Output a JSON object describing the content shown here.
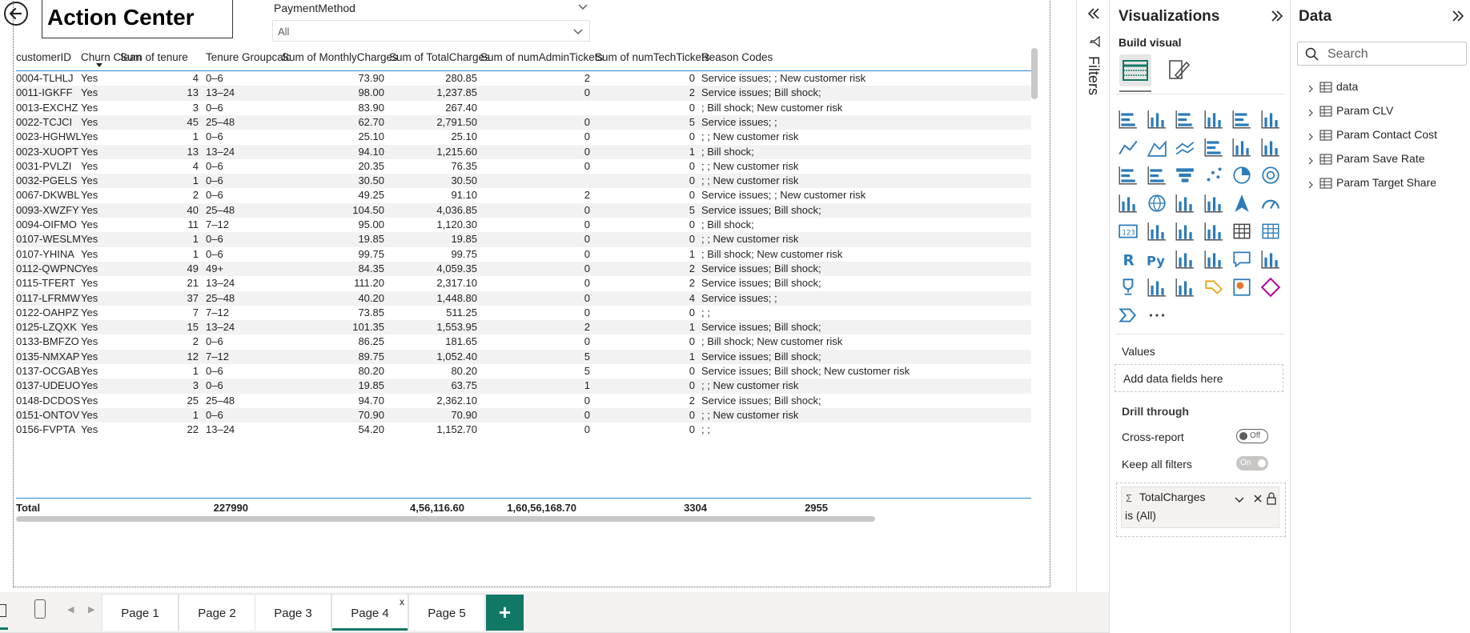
{
  "report": {
    "title": "Action Center",
    "slicer": {
      "title": "PaymentMethod",
      "value": "All"
    }
  },
  "table": {
    "columns": [
      "customerID",
      "Churn Clean",
      "Sum of tenure",
      "Tenure Groupcalc",
      "Sum of MonthlyCharges",
      "Sum of TotalCharges",
      "Sum of numAdminTickets",
      "Sum of numTechTickets",
      "Reason Codes"
    ],
    "rows": [
      [
        "0004-TLHLJ",
        "Yes",
        "4",
        "0–6",
        "73.90",
        "280.85",
        "2",
        "0",
        "Service issues; ; New customer risk"
      ],
      [
        "0011-IGKFF",
        "Yes",
        "13",
        "13–24",
        "98.00",
        "1,237.85",
        "0",
        "2",
        "Service issues; Bill shock;"
      ],
      [
        "0013-EXCHZ",
        "Yes",
        "3",
        "0–6",
        "83.90",
        "267.40",
        "",
        "0",
        "; Bill shock; New customer risk"
      ],
      [
        "0022-TCJCI",
        "Yes",
        "45",
        "25–48",
        "62.70",
        "2,791.50",
        "0",
        "5",
        "Service issues; ;"
      ],
      [
        "0023-HGHWL",
        "Yes",
        "1",
        "0–6",
        "25.10",
        "25.10",
        "0",
        "0",
        "; ; New customer risk"
      ],
      [
        "0023-XUOPT",
        "Yes",
        "13",
        "13–24",
        "94.10",
        "1,215.60",
        "0",
        "1",
        "; Bill shock;"
      ],
      [
        "0031-PVLZI",
        "Yes",
        "4",
        "0–6",
        "20.35",
        "76.35",
        "0",
        "0",
        "; ; New customer risk"
      ],
      [
        "0032-PGELS",
        "Yes",
        "1",
        "0–6",
        "30.50",
        "30.50",
        "",
        "0",
        "; ; New customer risk"
      ],
      [
        "0067-DKWBL",
        "Yes",
        "2",
        "0–6",
        "49.25",
        "91.10",
        "2",
        "0",
        "Service issues; ; New customer risk"
      ],
      [
        "0093-XWZFY",
        "Yes",
        "40",
        "25–48",
        "104.50",
        "4,036.85",
        "0",
        "5",
        "Service issues; Bill shock;"
      ],
      [
        "0094-OIFMO",
        "Yes",
        "11",
        "7–12",
        "95.00",
        "1,120.30",
        "0",
        "0",
        "; Bill shock;"
      ],
      [
        "0107-WESLM",
        "Yes",
        "1",
        "0–6",
        "19.85",
        "19.85",
        "0",
        "0",
        "; ; New customer risk"
      ],
      [
        "0107-YHINA",
        "Yes",
        "1",
        "0–6",
        "99.75",
        "99.75",
        "0",
        "1",
        "; Bill shock; New customer risk"
      ],
      [
        "0112-QWPNC",
        "Yes",
        "49",
        "49+",
        "84.35",
        "4,059.35",
        "0",
        "2",
        "Service issues; Bill shock;"
      ],
      [
        "0115-TFERT",
        "Yes",
        "21",
        "13–24",
        "111.20",
        "2,317.10",
        "0",
        "2",
        "Service issues; Bill shock;"
      ],
      [
        "0117-LFRMW",
        "Yes",
        "37",
        "25–48",
        "40.20",
        "1,448.80",
        "0",
        "4",
        "Service issues; ;"
      ],
      [
        "0122-OAHPZ",
        "Yes",
        "7",
        "7–12",
        "73.85",
        "511.25",
        "0",
        "0",
        "; ;"
      ],
      [
        "0125-LZQXK",
        "Yes",
        "15",
        "13–24",
        "101.35",
        "1,553.95",
        "2",
        "1",
        "Service issues; Bill shock;"
      ],
      [
        "0133-BMFZO",
        "Yes",
        "2",
        "0–6",
        "86.25",
        "181.65",
        "0",
        "0",
        "; Bill shock; New customer risk"
      ],
      [
        "0135-NMXAP",
        "Yes",
        "12",
        "7–12",
        "89.75",
        "1,052.40",
        "5",
        "1",
        "Service issues; Bill shock;"
      ],
      [
        "0137-OCGAB",
        "Yes",
        "1",
        "0–6",
        "80.20",
        "80.20",
        "5",
        "0",
        "Service issues; Bill shock; New customer risk"
      ],
      [
        "0137-UDEUO",
        "Yes",
        "3",
        "0–6",
        "19.85",
        "63.75",
        "1",
        "0",
        "; ; New customer risk"
      ],
      [
        "0148-DCDOS",
        "Yes",
        "25",
        "25–48",
        "94.70",
        "2,362.10",
        "0",
        "2",
        "Service issues; Bill shock;"
      ],
      [
        "0151-ONTOV",
        "Yes",
        "1",
        "0–6",
        "70.90",
        "70.90",
        "0",
        "0",
        "; ; New customer risk"
      ],
      [
        "0156-FVPTA",
        "Yes",
        "22",
        "13–24",
        "54.20",
        "1,152.70",
        "0",
        "0",
        "; ;"
      ]
    ],
    "total": {
      "label": "Total",
      "tenure": "227990",
      "monthly": "4,56,116.60",
      "totalcharges": "1,60,56,168.70",
      "admin": "3304",
      "tech": "2955"
    }
  },
  "filters_pane": {
    "label": "Filters"
  },
  "visualizations": {
    "title": "Visualizations",
    "build_label": "Build visual",
    "values_label": "Values",
    "values_placeholder": "Add data fields here",
    "drill_label": "Drill through",
    "cross_report_label": "Cross-report",
    "cross_report_state": "Off",
    "keep_filters_label": "Keep all filters",
    "keep_filters_state": "On",
    "filter_card": {
      "field": "TotalCharges",
      "condition": "is (All)"
    },
    "icons": [
      "stacked-bar-icon",
      "stacked-column-icon",
      "clustered-bar-icon",
      "clustered-column-icon",
      "100-stacked-bar-icon",
      "100-stacked-column-icon",
      "line-chart-icon",
      "area-chart-icon",
      "stacked-area-icon",
      "ribbon-chart-icon",
      "line-clustered-column-icon",
      "line-stacked-column-icon",
      "ribbon-combo-icon",
      "waterfall-icon",
      "funnel-icon",
      "scatter-icon",
      "pie-icon",
      "donut-icon",
      "treemap-icon",
      "map-icon",
      "filled-map-icon",
      "shape-map-icon",
      "azure-map-icon",
      "gauge-icon",
      "card-icon",
      "multi-row-card-icon",
      "kpi-icon",
      "slicer-icon",
      "table-icon",
      "matrix-icon",
      "r-visual-icon",
      "python-visual-icon",
      "key-influencers-icon",
      "decomposition-tree-icon",
      "qa-icon",
      "paginated-report-icon",
      "trophy-icon",
      "report-icon",
      "smart-narrative-icon",
      "power-automate-icon",
      "power-apps-icon",
      "diamond-icon",
      "chevron-visual-icon",
      "more-visuals-icon"
    ]
  },
  "data_pane": {
    "title": "Data",
    "search_placeholder": "Search",
    "items": [
      "data",
      "Param CLV",
      "Param Contact Cost",
      "Param Save Rate",
      "Param Target Share"
    ]
  },
  "pages": {
    "tabs": [
      "Page 1",
      "Page 2",
      "Page 3",
      "Page 4",
      "Page 5"
    ],
    "active": "Page 4",
    "close_glyph": "x",
    "add_glyph": "+"
  },
  "colors": {
    "accent": "#117865",
    "header_line": "#2b88d8",
    "viz_blue": "#2b7bb9",
    "row_alt": "#f2f2f2"
  }
}
